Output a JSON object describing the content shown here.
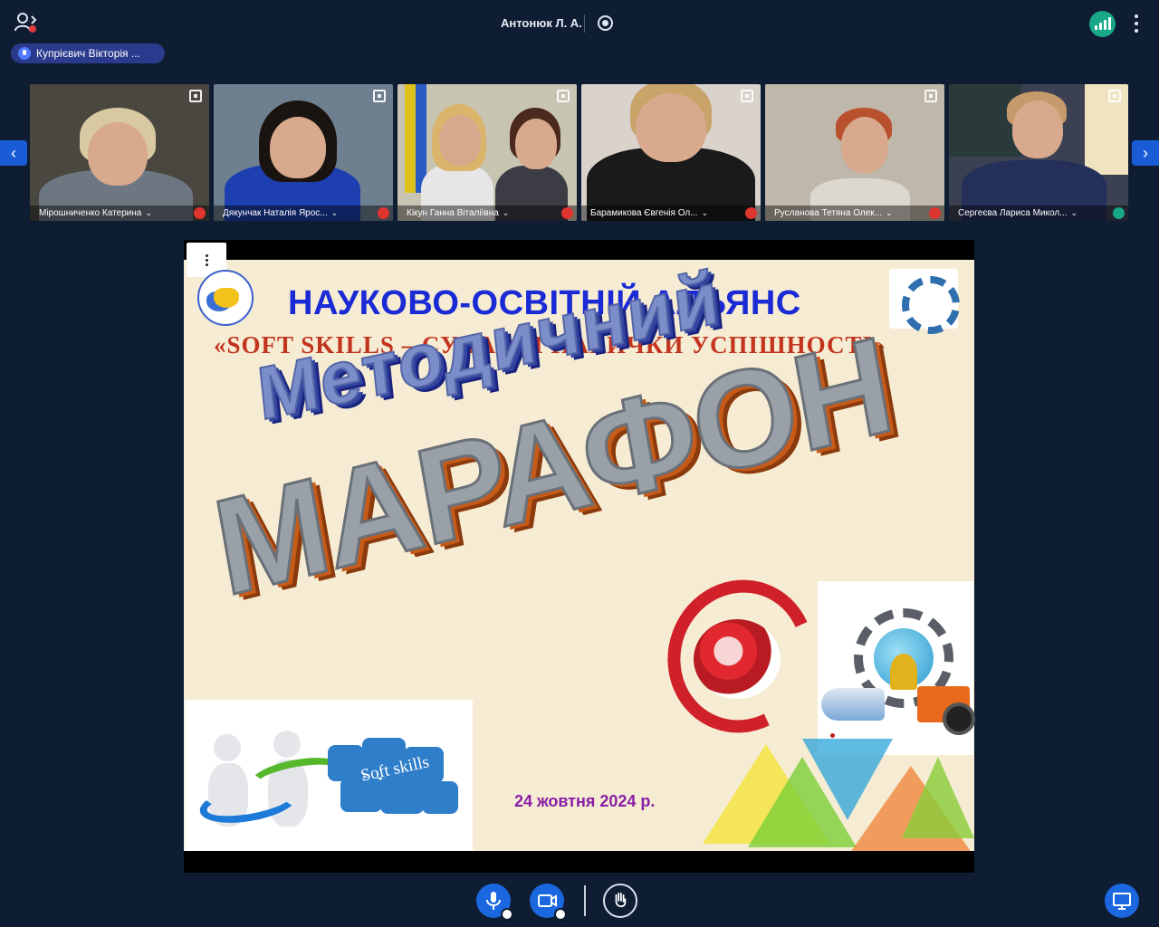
{
  "header": {
    "title": "Антонюк Л. А.",
    "speaker": "Купрієвич Вікторія ...",
    "icons": {
      "participants": "participants-icon",
      "record": "record-icon",
      "signal": "signal-icon",
      "more": "more-vertical-icon"
    }
  },
  "participants": [
    {
      "name": "Мірошниченко Катерина",
      "muted": true,
      "bg": "#4a4740"
    },
    {
      "name": "Дякунчак Наталія Ярос...",
      "muted": true,
      "bg": "#6e8090"
    },
    {
      "name": "Кікун Ганна Віталіївна",
      "muted": true,
      "bg": "#c8c4b2"
    },
    {
      "name": "Барамикова Євгенія Ол...",
      "muted": true,
      "bg": "#d9d3cc"
    },
    {
      "name": "Русланова Тетяна Олек...",
      "muted": true,
      "bg": "#bfb8aa"
    },
    {
      "name": "Сергеєва Лариса Микол...",
      "muted": false,
      "bg": "#3b4152"
    }
  ],
  "slide": {
    "alliance_title": "НАУКОВО-ОСВІТНІЙ АЛЬЯНС",
    "subtitle": "«SOFT SKILLS – СУЧАСНІ НАВИЧКИ УСПІШНОСТІ»",
    "heading_1": "Методичний",
    "heading_2": "МАРАФОН",
    "puzzle_label": "Soft skills",
    "date": "24 жовтня 2024 р."
  },
  "colors": {
    "background": "#0f1d33",
    "accent": "#1a67e0",
    "alliance_blue": "#1a2bd6",
    "subtitle_red": "#c2341e",
    "date_purple": "#8a1ea6"
  }
}
